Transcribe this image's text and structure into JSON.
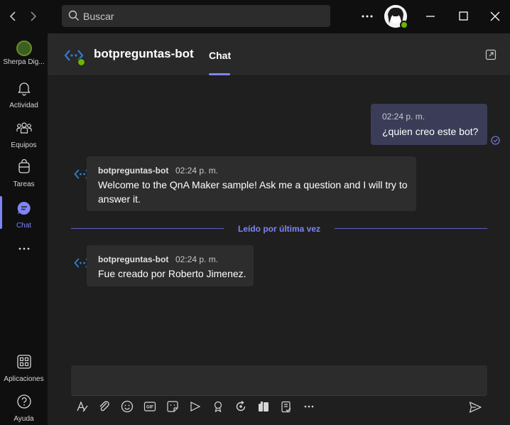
{
  "search": {
    "placeholder": "Buscar"
  },
  "rail": {
    "items": [
      {
        "label": "Sherpa Dig..."
      },
      {
        "label": "Actividad"
      },
      {
        "label": "Equipos"
      },
      {
        "label": "Tareas"
      },
      {
        "label": "Chat"
      },
      {
        "label": "Aplicaciones"
      },
      {
        "label": "Ayuda"
      }
    ]
  },
  "header": {
    "title": "botpreguntas-bot",
    "tab": "Chat"
  },
  "messages": [
    {
      "from": "me",
      "time": "02:24 p. m.",
      "text": "¿quien creo este bot?"
    },
    {
      "from": "bot",
      "sender": "botpreguntas-bot",
      "time": "02:24 p. m.",
      "text": "Welcome to the QnA Maker sample! Ask me a question and I will try to answer it."
    },
    {
      "from": "bot",
      "sender": "botpreguntas-bot",
      "time": "02:24 p. m.",
      "text": "Fue creado por Roberto Jimenez."
    }
  ],
  "divider": {
    "text": "Leído por última vez"
  },
  "compose": {
    "tools": [
      "format-icon",
      "attach-icon",
      "emoji-icon",
      "gif-icon",
      "sticker-icon",
      "meet-now-icon",
      "praise-icon",
      "loop-icon",
      "apps-icon",
      "approvals-icon",
      "more-icon"
    ]
  },
  "colors": {
    "accent": "#7f85f5",
    "presence": "#6bb700",
    "bubble_me": "#3b3d58",
    "bubble_bot": "#2d2d2d"
  }
}
